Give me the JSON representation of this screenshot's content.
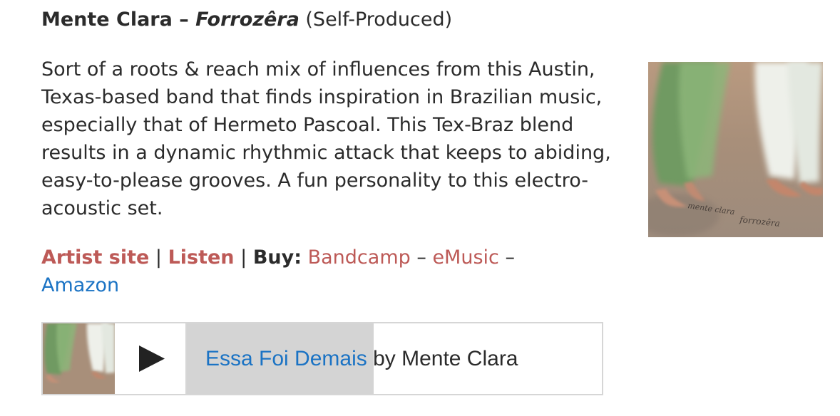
{
  "header": {
    "artist": "Mente Clara",
    "dash": " – ",
    "album": "Forrozêra",
    "label": " (Self-Produced)"
  },
  "review": {
    "text": "Sort of a roots & reach mix of influences from this Austin, Texas-based band that finds inspiration in Brazilian music, especially that of Hermeto Pascoal. This Tex-Braz blend results in a dynamic rhythmic attack that keeps to abiding, easy-to-please grooves. A fun personality to this electro-acoustic set."
  },
  "links": {
    "artist_site": "Artist site",
    "sep1": " | ",
    "listen": "Listen",
    "sep2": " | ",
    "buy_label": "Buy:",
    "bandcamp": "Bandcamp",
    "dash1": " – ",
    "emusic": "eMusic",
    "dash2": " –",
    "amazon": "Amazon"
  },
  "player": {
    "track": "Essa Foi Demais",
    "by": " by Mente Clara",
    "progress_fraction": 0.45
  },
  "colors": {
    "link_red": "#bd5a57",
    "link_blue": "#1b73c4",
    "text": "#2b2b2b",
    "progress": "#d4d4d4",
    "border": "#d6d6d6"
  },
  "icons": {
    "play": "play-icon"
  }
}
